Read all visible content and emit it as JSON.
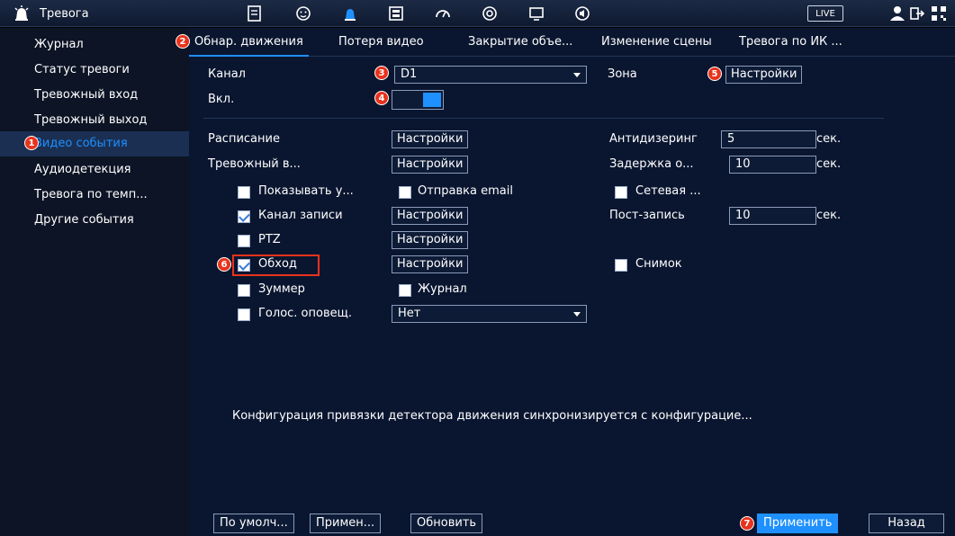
{
  "topbar": {
    "title": "Тревога",
    "live_label": "LIVE",
    "icons": [
      "alarm-icon",
      "file-search-icon",
      "face-icon",
      "alarm-light-icon",
      "storage-icon",
      "gauge-icon",
      "target-icon",
      "monitor-icon",
      "audio-icon",
      "user-icon",
      "logout-icon",
      "qr-icon"
    ]
  },
  "sidebar": {
    "items": [
      {
        "label": "Журнал"
      },
      {
        "label": "Статус тревоги"
      },
      {
        "label": "Тревожный вход"
      },
      {
        "label": "Тревожный выход"
      },
      {
        "label": "Видео события",
        "active": true
      },
      {
        "label": "Аудиодетекция"
      },
      {
        "label": "Тревога по темп..."
      },
      {
        "label": "Другие события"
      }
    ]
  },
  "tabs": [
    {
      "label": "Обнар. движения",
      "active": true
    },
    {
      "label": "Потеря видео"
    },
    {
      "label": "Закрытие объе..."
    },
    {
      "label": "Изменение сцены"
    },
    {
      "label": "Тревога по ИК ..."
    }
  ],
  "form": {
    "channel_label": "Канал",
    "channel_value": "D1",
    "enable_label": "Вкл.",
    "enable_on": true,
    "zone_label": "Зона",
    "zone_button": "Настройки",
    "schedule_label": "Расписание",
    "schedule_button": "Настройки",
    "antidither_label": "Антидизеринг",
    "antidither_value": "5",
    "antidither_unit": "сек.",
    "alarm_out_label": "Тревожный в...",
    "alarm_out_button": "Настройки",
    "delay_label": "Задержка о...",
    "delay_value": "10",
    "delay_unit": "сек.",
    "show_msg_label": "Показывать у...",
    "show_msg_checked": false,
    "send_email_label": "Отправка email",
    "send_email_checked": false,
    "network_label": "Сетевая ...",
    "network_checked": false,
    "record_channel_label": "Канал записи",
    "record_channel_checked": true,
    "record_channel_button": "Настройки",
    "post_record_label": "Пост-запись",
    "post_record_value": "10",
    "post_record_unit": "сек.",
    "ptz_label": "PTZ",
    "ptz_checked": false,
    "ptz_button": "Настройки",
    "tour_label": "Обход",
    "tour_checked": true,
    "tour_button": "Настройки",
    "snapshot_label": "Снимок",
    "snapshot_checked": false,
    "buzzer_label": "Зуммер",
    "buzzer_checked": false,
    "log_label": "Журнал",
    "log_checked": false,
    "voice_label": "Голос. оповещ.",
    "voice_checked": false,
    "voice_value": "Нет",
    "note": "Конфигурация привязки детектора движения синхронизируется с конфигурацие..."
  },
  "bottom": {
    "default_label": "По умолч...",
    "apply_to_label": "Примен...",
    "refresh_label": "Обновить",
    "apply_label": "Применить",
    "back_label": "Назад"
  },
  "badges": [
    "1",
    "2",
    "3",
    "4",
    "5",
    "6",
    "7"
  ],
  "colors": {
    "accent": "#1e90ff",
    "badge": "#e8331c",
    "background": "#0a1630"
  }
}
